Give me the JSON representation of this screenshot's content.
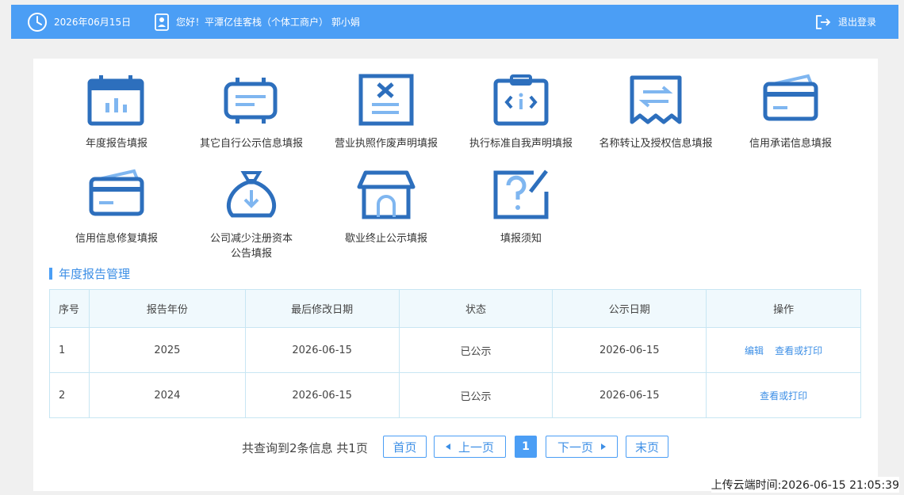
{
  "header": {
    "date": "2026年06月15日",
    "greeting": "您好！平潭亿佳客栈（个体工商户） 郭小娟",
    "logout": "退出登录"
  },
  "tiles": [
    {
      "label": "年度报告填报",
      "icon": "calendar-chart-icon"
    },
    {
      "label": "其它自行公示信息填报",
      "icon": "message-board-icon"
    },
    {
      "label": "营业执照作废声明填报",
      "icon": "license-void-icon"
    },
    {
      "label": "执行标准自我声明填报",
      "icon": "clipboard-code-icon"
    },
    {
      "label": "名称转让及授权信息填报",
      "icon": "transfer-document-icon"
    },
    {
      "label": "信用承诺信息填报",
      "icon": "credit-card-icon"
    },
    {
      "label": "信用信息修复填报",
      "icon": "credit-card-icon"
    },
    {
      "label": "公司减少注册资本",
      "label2": "公告填报",
      "icon": "money-bag-icon"
    },
    {
      "label": "歇业终止公示填报",
      "icon": "closed-store-icon"
    },
    {
      "label": "填报须知",
      "icon": "question-note-icon"
    }
  ],
  "section": {
    "title": "年度报告管理"
  },
  "table": {
    "headers": [
      "序号",
      "报告年份",
      "最后修改日期",
      "状态",
      "公示日期",
      "操作"
    ],
    "rows": [
      {
        "idx": "1",
        "year": "2025",
        "modified": "2026-06-15",
        "status": "已公示",
        "published": "2026-06-15",
        "actions": [
          "编辑",
          "查看或打印"
        ]
      },
      {
        "idx": "2",
        "year": "2024",
        "modified": "2026-06-15",
        "status": "已公示",
        "published": "2026-06-15",
        "actions": [
          "查看或打印"
        ]
      }
    ]
  },
  "pager": {
    "info": "共查询到2条信息 共1页",
    "first": "首页",
    "prev": "上一页",
    "current": "1",
    "next": "下一页",
    "last": "末页"
  },
  "footer": {
    "upload_time": "上传云端时间:2026-06-15 21:05:39"
  },
  "colors": {
    "accent": "#4b9ef5",
    "link": "#3d8fe6",
    "icon_dark": "#2d6fbd",
    "icon_light": "#7fb6f0"
  }
}
